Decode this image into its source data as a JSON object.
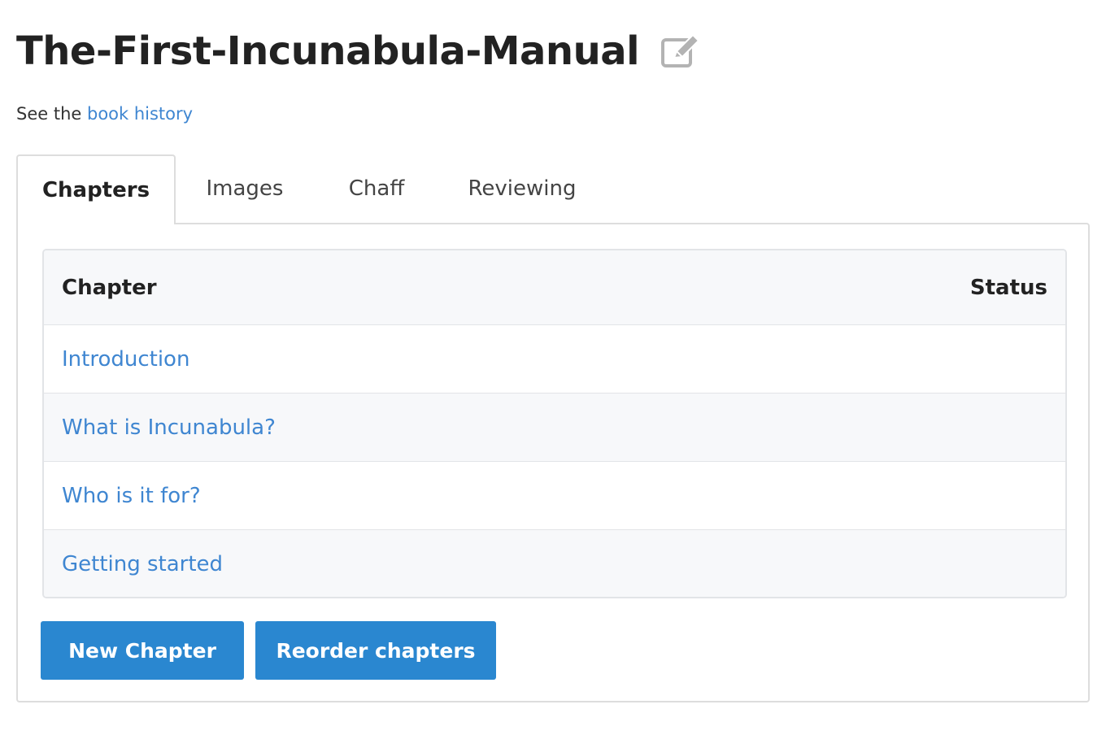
{
  "book": {
    "title": "The-First-Incunabula-Manual"
  },
  "history": {
    "prefix": "See the ",
    "link_label": "book history"
  },
  "tabs": [
    {
      "label": "Chapters",
      "active": true
    },
    {
      "label": "Images",
      "active": false
    },
    {
      "label": "Chaff",
      "active": false
    },
    {
      "label": "Reviewing",
      "active": false
    }
  ],
  "table": {
    "columns": {
      "chapter": "Chapter",
      "status": "Status"
    },
    "rows": [
      {
        "chapter": "Introduction",
        "status": ""
      },
      {
        "chapter": "What is Incunabula?",
        "status": ""
      },
      {
        "chapter": "Who is it for?",
        "status": ""
      },
      {
        "chapter": "Getting started",
        "status": ""
      }
    ]
  },
  "actions": {
    "new_chapter": "New Chapter",
    "reorder_chapters": "Reorder chapters"
  },
  "icons": {
    "edit": "edit-icon"
  },
  "colors": {
    "link": "#3f86d1",
    "button": "#2a87d0"
  }
}
